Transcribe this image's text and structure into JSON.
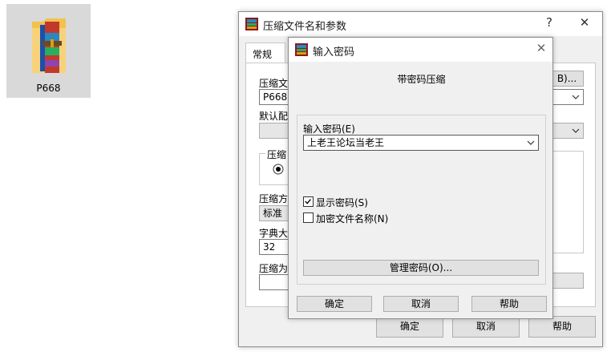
{
  "desktop": {
    "file_label": "P668"
  },
  "back_window": {
    "title": "压缩文件名和参数",
    "help_glyph": "?",
    "close_glyph": "✕",
    "tab_general": "常规",
    "archive_label": "压缩文",
    "archive_value": "P668.r",
    "browse_label": "B)...",
    "profile_label": "默认配",
    "format_group_label": "压缩",
    "method_label": "压缩方",
    "method_value": "标准",
    "dict_label": "字典大",
    "dict_value": "32",
    "split_label": "压缩为",
    "ok_label": "确定",
    "cancel_label": "取消",
    "help_label": "帮助"
  },
  "dialog": {
    "title": "输入密码",
    "close_glyph": "✕",
    "heading": "带密码压缩",
    "password_label": "输入密码(E)",
    "password_value": "上老王论坛当老王",
    "show_password_label": "显示密码(S)",
    "show_password_checked": true,
    "encrypt_names_label": "加密文件名称(N)",
    "encrypt_names_checked": false,
    "manage_label": "管理密码(O)...",
    "ok_label": "确定",
    "cancel_label": "取消",
    "help_label": "帮助"
  }
}
